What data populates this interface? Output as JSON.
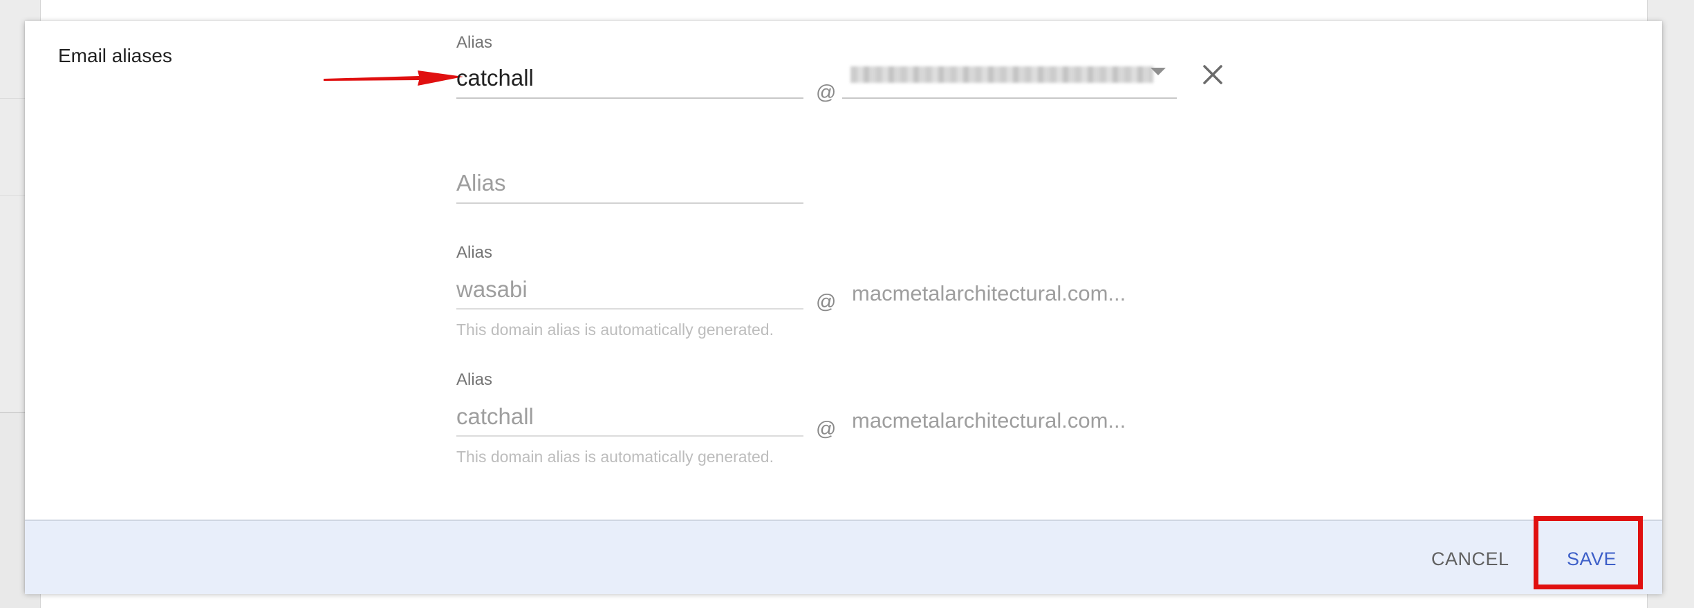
{
  "section": {
    "title": "Email aliases"
  },
  "aliases": [
    {
      "label": "Alias",
      "value": "catchall",
      "at": "@",
      "domain_blurred": true,
      "removable": true
    },
    {
      "placeholder": "Alias"
    },
    {
      "label": "Alias",
      "value": "wasabi",
      "at": "@",
      "domain": "macmetalarchitectural.com...",
      "helper": "This domain alias is automatically generated."
    },
    {
      "label": "Alias",
      "value": "catchall",
      "at": "@",
      "domain": "macmetalarchitectural.com...",
      "helper": "This domain alias is automatically generated."
    }
  ],
  "footer": {
    "cancel_label": "CANCEL",
    "save_label": "SAVE"
  },
  "colors": {
    "annotation": "#e01010",
    "save": "#3d5fc8",
    "footer_bg": "#e8eefa"
  },
  "icons": [
    "close-icon",
    "dropdown-arrow-icon",
    "annotation-arrow"
  ]
}
